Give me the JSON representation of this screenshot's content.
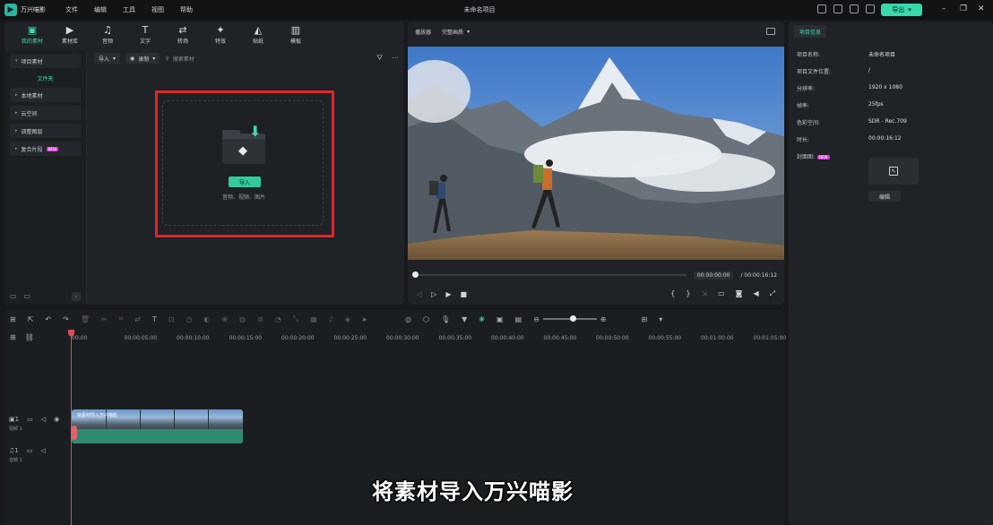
{
  "titlebar": {
    "app_name": "万兴喵影",
    "menu": [
      "文件",
      "编辑",
      "工具",
      "视图",
      "帮助"
    ],
    "project_title": "未命名项目",
    "export_label": "导出"
  },
  "media_tabs": [
    {
      "icon": "folder-media-icon",
      "glyph": "▣",
      "label": "我的素材",
      "active": true
    },
    {
      "icon": "library-icon",
      "glyph": "▶",
      "label": "素材库",
      "active": false
    },
    {
      "icon": "music-icon",
      "glyph": "♫",
      "label": "音频",
      "active": false
    },
    {
      "icon": "text-icon",
      "glyph": "T",
      "label": "文字",
      "active": false
    },
    {
      "icon": "transition-icon",
      "glyph": "⇄",
      "label": "转场",
      "active": false
    },
    {
      "icon": "effects-icon",
      "glyph": "✦",
      "label": "特效",
      "active": false
    },
    {
      "icon": "sticker-icon",
      "glyph": "◭",
      "label": "贴纸",
      "active": false
    },
    {
      "icon": "template-icon",
      "glyph": "▥",
      "label": "模板",
      "active": false
    }
  ],
  "sidebar": {
    "project_media": "项目素材",
    "folder": "文件夹",
    "local_media": "本地素材",
    "cloud": "云空间",
    "adjustment_layer": "调整图层",
    "compound_clip": "复合片段",
    "new_badge": "NEW"
  },
  "media_toolbar": {
    "import_label": "导入",
    "record_label": "录制",
    "search_placeholder": "搜索素材"
  },
  "import_zone": {
    "button": "导入",
    "hint": "音频、视频、图片"
  },
  "player": {
    "label": "播放器",
    "quality": "完整画质",
    "current_time": "00:00:00:00",
    "total_time": "/ 00:00:16:12"
  },
  "properties": {
    "tab": "项目信息",
    "rows": [
      {
        "k": "项目名称:",
        "v": "未命名项目"
      },
      {
        "k": "项目文件位置:",
        "v": "/"
      },
      {
        "k": "分辨率:",
        "v": "1920 x 1080"
      },
      {
        "k": "帧率:",
        "v": "25fps"
      },
      {
        "k": "色彩空间:",
        "v": "SDR - Rec.709"
      },
      {
        "k": "时长:",
        "v": "00:00:16:12"
      }
    ],
    "cover_label": "封面图:",
    "new_badge": "NEW",
    "edit_btn": "编辑"
  },
  "timeline": {
    "ruler": [
      "00:00",
      "00:00:05:00",
      "00:00:10:00",
      "00:00:15:00",
      "00:00:20:00",
      "00:00:25:00",
      "00:00:30:00",
      "00:00:35:00",
      "00:00:40:00",
      "00:00:45:00",
      "00:00:50:00",
      "00:00:55:00",
      "00:01:00:00",
      "00:01:05:00"
    ],
    "video_track": "视频 1",
    "video_track_num": "1",
    "audio_track": "音频 1",
    "audio_track_num": "1",
    "clip_name": "将素材导入万兴喵影"
  },
  "subtitle_overlay": "将素材导入万兴喵影",
  "colors": {
    "accent": "#38d7ac",
    "highlight_frame": "#e0262a",
    "playhead": "#e04a55"
  }
}
